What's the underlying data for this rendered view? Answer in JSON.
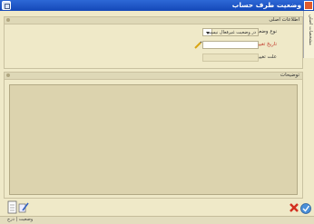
{
  "window": {
    "title": "وضعیت طرف حساب"
  },
  "side_tab": {
    "label": "مشخصات اصلی"
  },
  "main_info": {
    "section_label": "اطلاعات اصلی",
    "status_type_label": "نوع وضعیت",
    "status_type_value": "در وضعیت غیرفعال نیست",
    "change_date_label": "تاریخ تغییر",
    "change_date_value": "",
    "change_reason_label": "علت تغییر"
  },
  "notes": {
    "section_label": "توضیحات",
    "value": ""
  },
  "status_bar": {
    "text": "وضعیت | درج"
  },
  "colors": {
    "title_bar": "#2d68d6",
    "background": "#efe9c8",
    "required_label": "#c0392b",
    "notes_area": "#dcd3ae"
  }
}
